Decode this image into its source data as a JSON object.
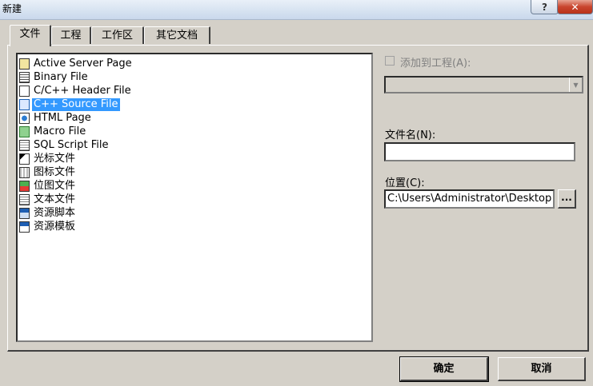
{
  "window": {
    "title": "新建",
    "help_label": "?",
    "close_label": "✕"
  },
  "tabs": [
    {
      "label": "文件",
      "active": true
    },
    {
      "label": "工程",
      "active": false
    },
    {
      "label": "工作区",
      "active": false
    },
    {
      "label": "其它文档",
      "active": false
    }
  ],
  "file_types": [
    {
      "label": "Active Server Page",
      "icon": "asp-file-icon"
    },
    {
      "label": "Binary File",
      "icon": "binary-file-icon"
    },
    {
      "label": "C/C++ Header File",
      "icon": "header-file-icon"
    },
    {
      "label": "C++ Source File",
      "icon": "cpp-source-icon",
      "selected": true
    },
    {
      "label": "HTML Page",
      "icon": "html-page-icon"
    },
    {
      "label": "Macro File",
      "icon": "macro-file-icon"
    },
    {
      "label": "SQL Script File",
      "icon": "sql-script-icon"
    },
    {
      "label": "光标文件",
      "icon": "cursor-file-icon"
    },
    {
      "label": "图标文件",
      "icon": "icon-file-icon"
    },
    {
      "label": "位图文件",
      "icon": "bitmap-file-icon"
    },
    {
      "label": "文本文件",
      "icon": "text-file-icon"
    },
    {
      "label": "资源脚本",
      "icon": "resource-script-icon"
    },
    {
      "label": "资源模板",
      "icon": "resource-template-icon"
    }
  ],
  "add_to_project": {
    "label": "添加到工程(A):",
    "checked": false,
    "enabled": false,
    "combo_value": ""
  },
  "filename": {
    "label": "文件名(N):",
    "value": ""
  },
  "location": {
    "label": "位置(C):",
    "value": "C:\\Users\\Administrator\\Desktop",
    "browse_label": "..."
  },
  "buttons": {
    "ok": "确定",
    "cancel": "取消"
  }
}
